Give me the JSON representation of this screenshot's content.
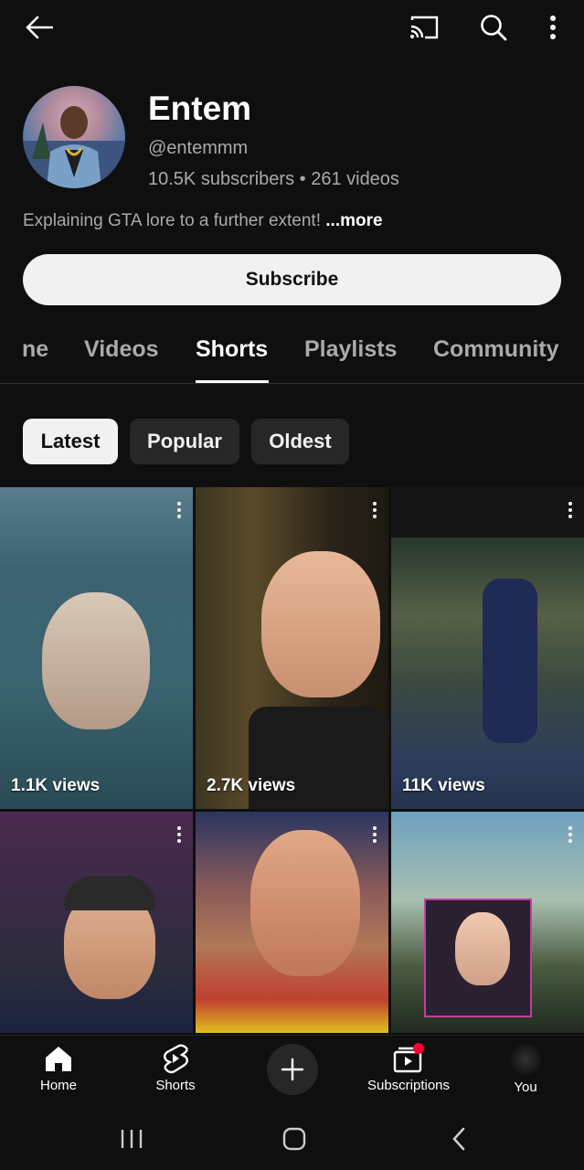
{
  "topbar": {
    "back": "back-arrow-icon",
    "cast": "cast-icon",
    "search": "search-icon",
    "more": "more-vert-icon"
  },
  "channel": {
    "name": "Entem",
    "handle": "@entemmm",
    "stats": "10.5K subscribers • 261 videos",
    "description": "Explaining GTA lore to a further extent! ",
    "more_label": "...more",
    "subscribe_label": "Subscribe"
  },
  "tabs": [
    {
      "label": "ne"
    },
    {
      "label": "Videos"
    },
    {
      "label": "Shorts",
      "active": true
    },
    {
      "label": "Playlists"
    },
    {
      "label": "Community"
    }
  ],
  "filters": [
    {
      "label": "Latest",
      "selected": true
    },
    {
      "label": "Popular"
    },
    {
      "label": "Oldest"
    }
  ],
  "shorts": [
    {
      "views": "1.1K views"
    },
    {
      "views": "2.7K views"
    },
    {
      "views": "11K views"
    },
    {
      "views": ""
    },
    {
      "views": ""
    },
    {
      "views": ""
    }
  ],
  "bottom_nav": [
    {
      "label": "Home",
      "icon": "home-icon"
    },
    {
      "label": "Shorts",
      "icon": "shorts-icon"
    },
    {
      "label": "",
      "icon": "create-plus-icon"
    },
    {
      "label": "Subscriptions",
      "icon": "subscriptions-icon"
    },
    {
      "label": "You",
      "icon": "profile-avatar-icon"
    }
  ],
  "colors": {
    "background": "#0f0f0f",
    "text": "#f1f1f1",
    "secondary_text": "#aaaaaa",
    "chip_bg": "#272727",
    "notification_dot": "#ff0033"
  }
}
